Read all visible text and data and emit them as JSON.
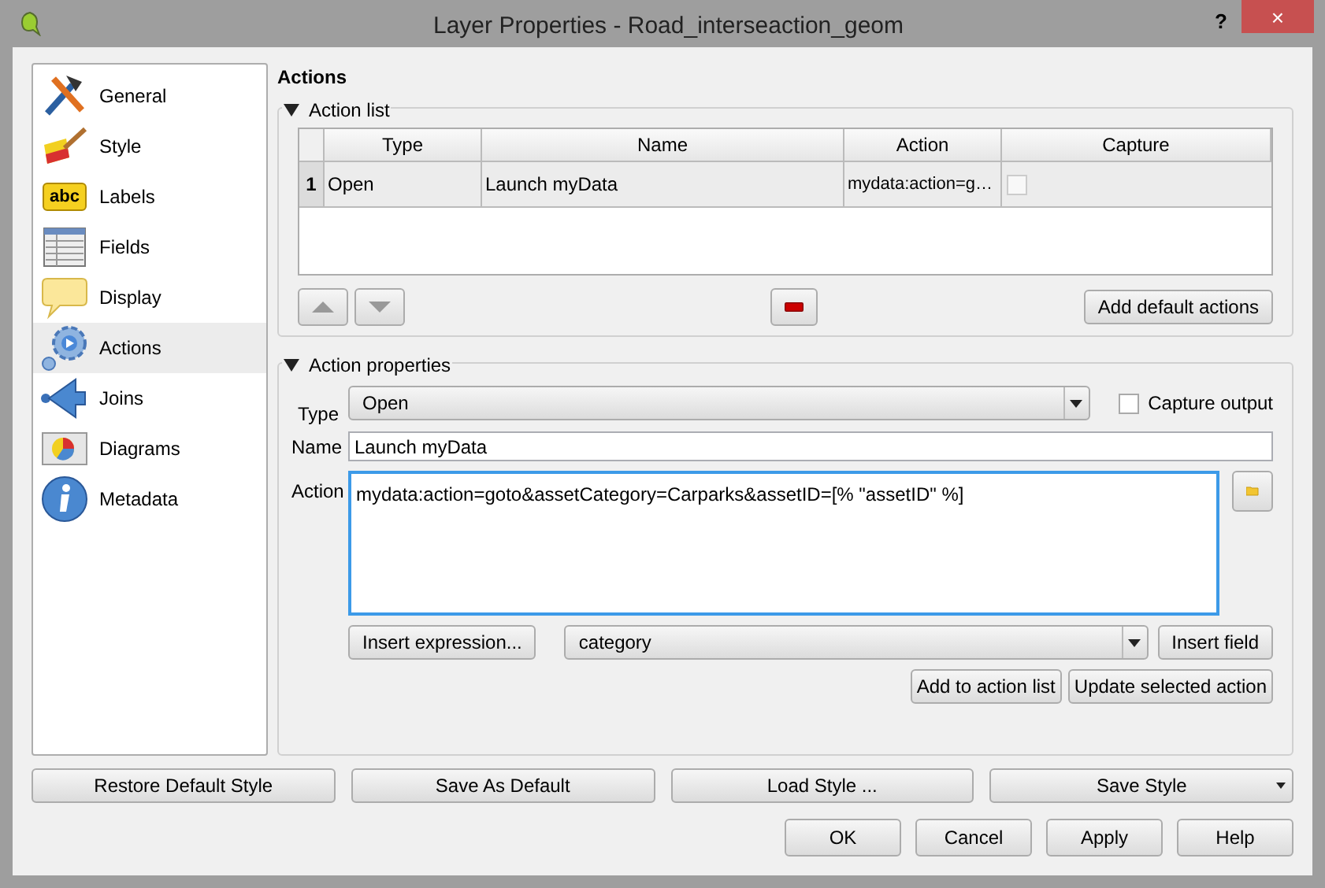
{
  "window": {
    "title": "Layer Properties - Road_interseaction_geom",
    "help": "?",
    "close": "×"
  },
  "sidebar": {
    "items": [
      {
        "kind": "general",
        "label": "General",
        "selected": false
      },
      {
        "kind": "style",
        "label": "Style",
        "selected": false
      },
      {
        "kind": "labels",
        "label": "Labels",
        "selected": false,
        "icon_text": "abc"
      },
      {
        "kind": "fields",
        "label": "Fields",
        "selected": false
      },
      {
        "kind": "display",
        "label": "Display",
        "selected": false
      },
      {
        "kind": "actions",
        "label": "Actions",
        "selected": true
      },
      {
        "kind": "joins",
        "label": "Joins",
        "selected": false
      },
      {
        "kind": "diagrams",
        "label": "Diagrams",
        "selected": false
      },
      {
        "kind": "metadata",
        "label": "Metadata",
        "selected": false
      }
    ]
  },
  "page_title": "Actions",
  "action_list": {
    "title": "Action list",
    "expanded": true,
    "table": {
      "columns": [
        "Type",
        "Name",
        "Action",
        "Capture"
      ],
      "rows": [
        {
          "number": "1",
          "type": "Open",
          "name": "Launch myData",
          "action": "mydata:action=g…",
          "capture": false
        }
      ]
    },
    "add_default": "Add default actions"
  },
  "action_properties": {
    "title": "Action properties",
    "expanded": true,
    "type_label": "Type",
    "type_value": "Open",
    "capture_output": {
      "label": "Capture output",
      "checked": false
    },
    "name_label": "Name",
    "name_value": "Launch myData",
    "action_label": "Action",
    "action_value": "mydata:action=goto&assetCategory=Carparks&assetID=[% \"assetID\" %]",
    "insert_expression": "Insert expression...",
    "field_value": "category",
    "insert_field": "Insert field",
    "add_to_list": "Add to action list",
    "update_selected": "Update selected action"
  },
  "style_buttons": [
    "Restore Default Style",
    "Save As Default",
    "Load Style ...",
    "Save Style"
  ],
  "dialog_buttons": [
    "OK",
    "Cancel",
    "Apply",
    "Help"
  ]
}
